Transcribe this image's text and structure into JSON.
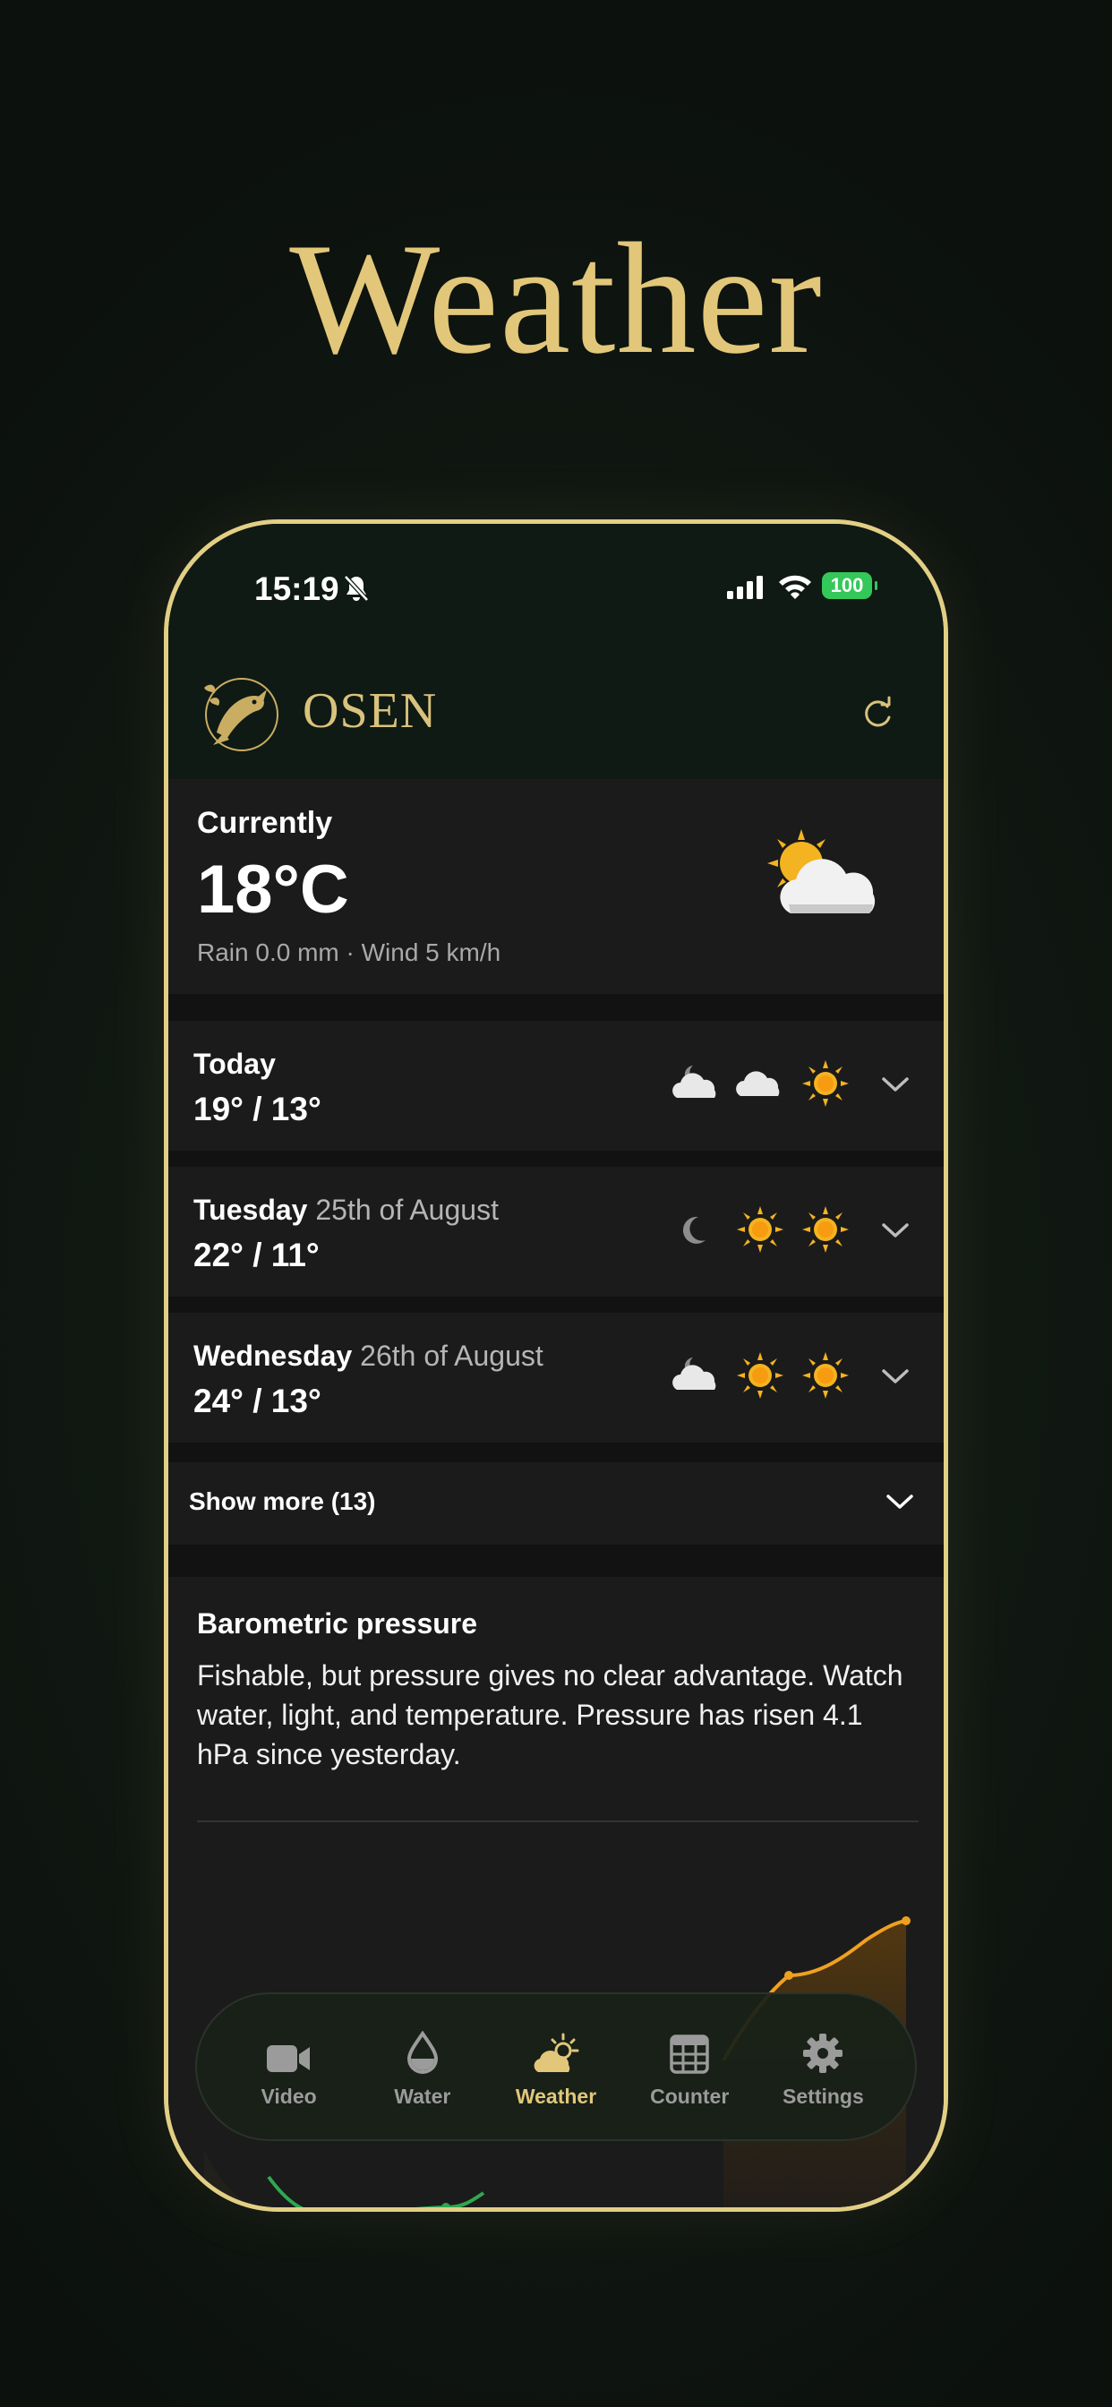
{
  "headline": "Weather",
  "status_bar": {
    "time": "15:19",
    "battery": "100"
  },
  "app": {
    "brand": "OSEN"
  },
  "current": {
    "label": "Currently",
    "temperature": "18°C",
    "details": "Rain 0.0 mm · Wind 5 km/h",
    "icon": "sun-behind-cloud-icon"
  },
  "days": [
    {
      "name": "Today",
      "date": "",
      "range": "19° / 13°",
      "icons": [
        "cloud-moon-icon",
        "cloud-icon",
        "sun-icon"
      ]
    },
    {
      "name": "Tuesday",
      "date": "25th of August",
      "range": "22° / 11°",
      "icons": [
        "moon-icon",
        "sun-icon",
        "sun-icon"
      ]
    },
    {
      "name": "Wednesday",
      "date": "26th of August",
      "range": "24° / 13°",
      "icons": [
        "cloud-moon-icon",
        "sun-icon",
        "sun-icon"
      ]
    }
  ],
  "show_more": "Show more (13)",
  "pressure": {
    "title": "Barometric pressure",
    "text": "Fishable, but pressure gives no clear advantage. Watch water, light, and temperature. Pressure has risen 4.1 hPa since yesterday."
  },
  "nav": {
    "items": [
      {
        "label": "Video",
        "icon": "video-camera-icon"
      },
      {
        "label": "Water",
        "icon": "water-drop-icon"
      },
      {
        "label": "Weather",
        "icon": "weather-icon"
      },
      {
        "label": "Counter",
        "icon": "grid-icon"
      },
      {
        "label": "Settings",
        "icon": "gear-icon"
      }
    ],
    "active": "Weather"
  },
  "colors": {
    "accent": "#e2c77a",
    "battery": "#34c759",
    "rising": "#f0a020",
    "falling": "#2fa84f"
  }
}
